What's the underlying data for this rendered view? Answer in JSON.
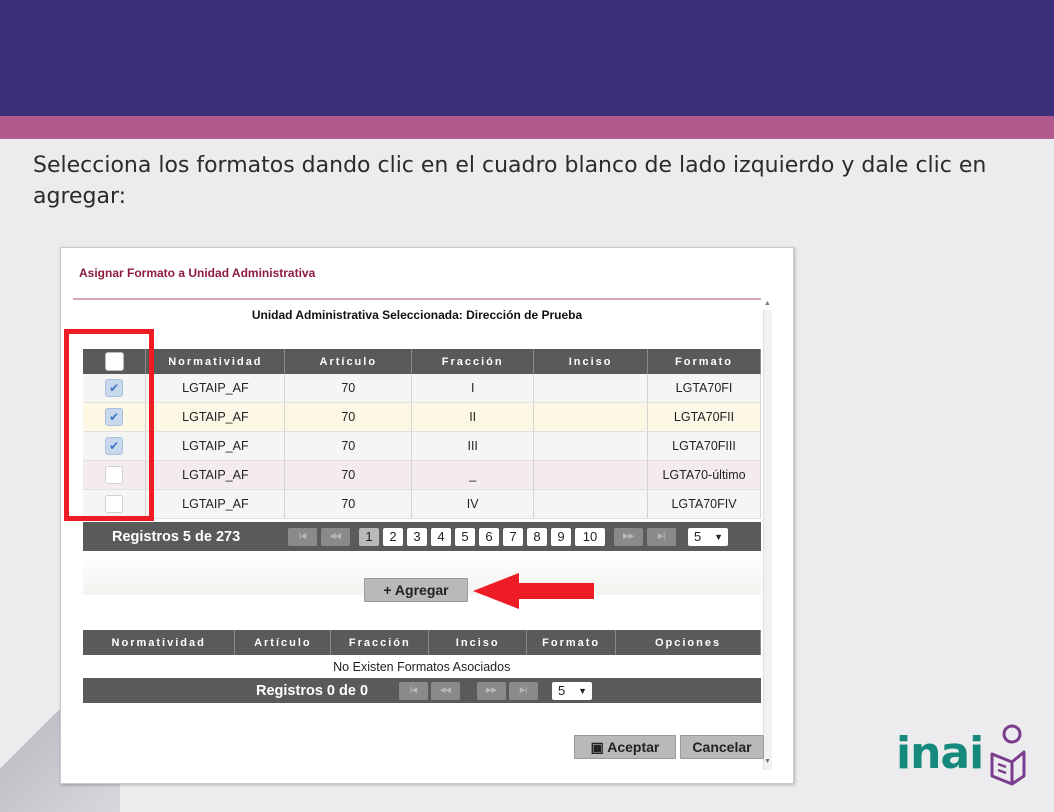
{
  "slide": {
    "instruction": "Selecciona los formatos dando clic en el cuadro blanco de lado izquierdo y dale clic en agregar:",
    "colors": {
      "header_band": "#3d2f7c",
      "accent_band": "#b05a8e",
      "highlight": "#ee1c24",
      "logo": "#158a7c"
    },
    "logo_text": "inai"
  },
  "dialog": {
    "title": "Asignar Formato a Unidad Administrativa",
    "unit_label": "Unidad Administrativa Seleccionada: Dirección de Prueba",
    "formats_table": {
      "headers": [
        "Normatividad",
        "Artículo",
        "Fracción",
        "Inciso",
        "Formato"
      ],
      "rows": [
        {
          "checked": true,
          "normatividad": "LGTAIP_AF",
          "articulo": "70",
          "fraccion": "I",
          "inciso": "",
          "formato": "LGTA70FI"
        },
        {
          "checked": true,
          "normatividad": "LGTAIP_AF",
          "articulo": "70",
          "fraccion": "II",
          "inciso": "",
          "formato": "LGTA70FII"
        },
        {
          "checked": true,
          "normatividad": "LGTAIP_AF",
          "articulo": "70",
          "fraccion": "III",
          "inciso": "",
          "formato": "LGTA70FIII"
        },
        {
          "checked": false,
          "normatividad": "LGTAIP_AF",
          "articulo": "70",
          "fraccion": "_",
          "inciso": "",
          "formato": "LGTA70-último"
        },
        {
          "checked": false,
          "normatividad": "LGTAIP_AF",
          "articulo": "70",
          "fraccion": "IV",
          "inciso": "",
          "formato": "LGTA70FIV"
        }
      ]
    },
    "pager_top": {
      "registros": "Registros 5 de 273",
      "pages": [
        "1",
        "2",
        "3",
        "4",
        "5",
        "6",
        "7",
        "8",
        "9",
        "10"
      ],
      "current_page": "1",
      "page_size": "5"
    },
    "add_button": "Agregar",
    "assoc_table": {
      "headers": [
        "Normatividad",
        "Artículo",
        "Fracción",
        "Inciso",
        "Formato",
        "Opciones"
      ],
      "empty_message": "No Existen Formatos Asociados"
    },
    "pager_bottom": {
      "registros": "Registros 0 de 0",
      "page_size": "5"
    },
    "accept_button": "Aceptar",
    "cancel_button": "Cancelar"
  }
}
